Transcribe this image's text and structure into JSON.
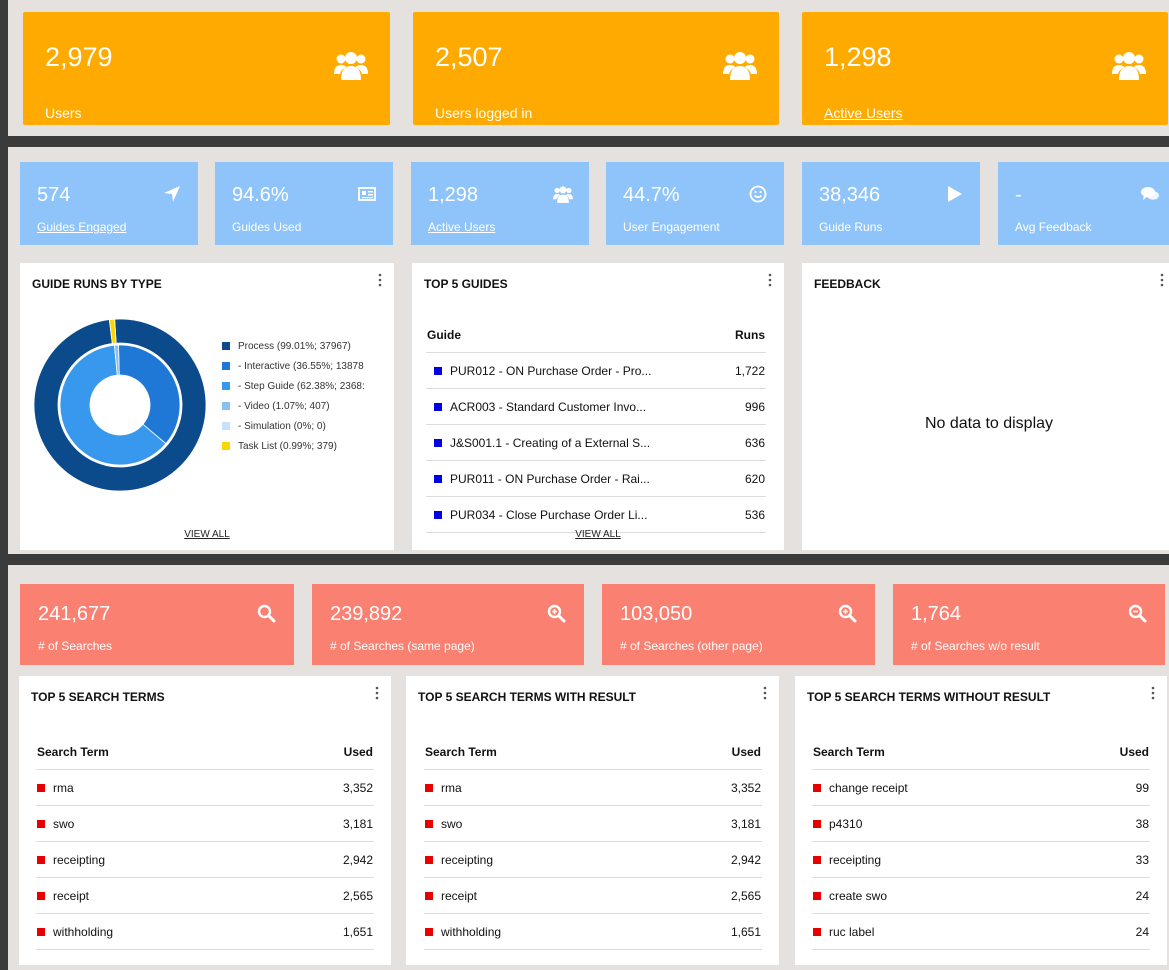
{
  "top_kpis": [
    {
      "value": "2,979",
      "label": "Users",
      "link": false,
      "icon": "users-icon"
    },
    {
      "value": "2,507",
      "label": "Users logged in",
      "link": false,
      "icon": "users-icon"
    },
    {
      "value": "1,298",
      "label": "Active Users",
      "link": true,
      "icon": "users-icon"
    }
  ],
  "guide_kpis": [
    {
      "value": "574",
      "label": "Guides Engaged",
      "link": true,
      "icon": "location-arrow-icon"
    },
    {
      "value": "94.6%",
      "label": "Guides Used",
      "link": false,
      "icon": "newspaper-icon"
    },
    {
      "value": "1,298",
      "label": "Active Users",
      "link": true,
      "icon": "users-icon"
    },
    {
      "value": "44.7%",
      "label": "User Engagement",
      "link": false,
      "icon": "smile-icon"
    },
    {
      "value": "38,346",
      "label": "Guide Runs",
      "link": false,
      "icon": "play-icon"
    },
    {
      "value": "-",
      "label": "Avg Feedback",
      "link": false,
      "icon": "comments-icon"
    }
  ],
  "guide_runs": {
    "title": "GUIDE RUNS BY TYPE",
    "view_all": "VIEW ALL",
    "legend": [
      {
        "text": "Process (99.01%; 37967)",
        "color": "#0b4a8b"
      },
      {
        "text": "- Interactive (36.55%; 13878",
        "color": "#1f78d6"
      },
      {
        "text": "- Step Guide (62.38%; 2368:",
        "color": "#3898ee"
      },
      {
        "text": "- Video (1.07%; 407)",
        "color": "#88c0f2"
      },
      {
        "text": "- Simulation (0%; 0)",
        "color": "#c6e1f9"
      },
      {
        "text": "Task List (0.99%; 379)",
        "color": "#ffd500"
      }
    ]
  },
  "chart_data": {
    "type": "pie",
    "title": "GUIDE RUNS BY TYPE",
    "rings": [
      {
        "name": "outer",
        "slices": [
          {
            "label": "Process",
            "percent": 99.01,
            "value": 37967,
            "color": "#0b4a8b"
          },
          {
            "label": "Task List",
            "percent": 0.99,
            "value": 379,
            "color": "#ffd500"
          }
        ]
      },
      {
        "name": "inner",
        "slices": [
          {
            "label": "Interactive",
            "percent": 36.55,
            "value": 13878,
            "color": "#1f78d6"
          },
          {
            "label": "Step Guide",
            "percent": 62.38,
            "color": "#3898ee"
          },
          {
            "label": "Video",
            "percent": 1.07,
            "value": 407,
            "color": "#88c0f2"
          },
          {
            "label": "Simulation",
            "percent": 0,
            "value": 0,
            "color": "#c6e1f9"
          }
        ]
      }
    ],
    "legend_position": "right"
  },
  "top_guides": {
    "title": "TOP 5 GUIDES",
    "col_guide": "Guide",
    "col_runs": "Runs",
    "view_all": "VIEW ALL",
    "rows": [
      {
        "name": "PUR012 - ON Purchase Order - Pro...",
        "runs": "1,722"
      },
      {
        "name": "ACR003 - Standard Customer Invo...",
        "runs": "996"
      },
      {
        "name": "J&S001.1 - Creating of a External S...",
        "runs": "636"
      },
      {
        "name": "PUR011 - ON Purchase Order - Rai...",
        "runs": "620"
      },
      {
        "name": "PUR034 - Close Purchase Order Li...",
        "runs": "536"
      }
    ]
  },
  "feedback": {
    "title": "FEEDBACK",
    "empty": "No data to display"
  },
  "search_kpis": [
    {
      "value": "241,677",
      "label": "# of Searches",
      "icon": "search-icon"
    },
    {
      "value": "239,892",
      "label": "# of Searches (same page)",
      "icon": "search-plus-icon"
    },
    {
      "value": "103,050",
      "label": "# of Searches (other page)",
      "icon": "search-plus-icon"
    },
    {
      "value": "1,764",
      "label": "# of Searches w/o result",
      "icon": "search-minus-icon"
    }
  ],
  "search_tables": [
    {
      "title": "TOP 5 SEARCH TERMS",
      "col_term": "Search Term",
      "col_used": "Used",
      "rows": [
        {
          "term": "rma",
          "used": "3,352"
        },
        {
          "term": "swo",
          "used": "3,181"
        },
        {
          "term": "receipting",
          "used": "2,942"
        },
        {
          "term": "receipt",
          "used": "2,565"
        },
        {
          "term": "withholding",
          "used": "1,651"
        }
      ]
    },
    {
      "title": "TOP 5 SEARCH TERMS WITH RESULT",
      "col_term": "Search Term",
      "col_used": "Used",
      "rows": [
        {
          "term": "rma",
          "used": "3,352"
        },
        {
          "term": "swo",
          "used": "3,181"
        },
        {
          "term": "receipting",
          "used": "2,942"
        },
        {
          "term": "receipt",
          "used": "2,565"
        },
        {
          "term": "withholding",
          "used": "1,651"
        }
      ]
    },
    {
      "title": "TOP 5 SEARCH TERMS WITHOUT RESULT",
      "col_term": "Search Term",
      "col_used": "Used",
      "rows": [
        {
          "term": "change receipt",
          "used": "99"
        },
        {
          "term": "p4310",
          "used": "38"
        },
        {
          "term": "receipting",
          "used": "33"
        },
        {
          "term": "create swo",
          "used": "24"
        },
        {
          "term": "ruc label",
          "used": "24"
        }
      ]
    }
  ],
  "colors": {
    "orange": "#ffaa00",
    "blue": "#8ec4fa",
    "salmon": "#fa8072",
    "guide_square": "#0000e0",
    "search_square": "#e60000"
  }
}
